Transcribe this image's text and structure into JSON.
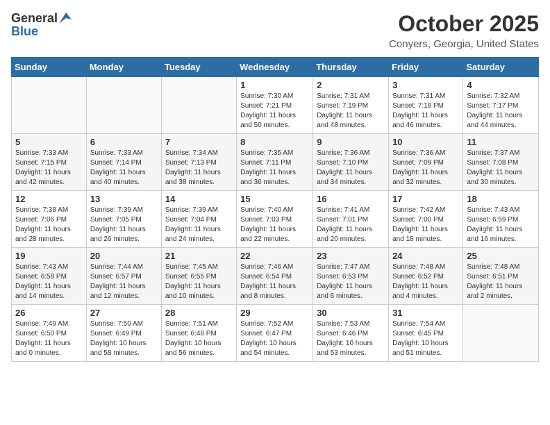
{
  "header": {
    "logo_general": "General",
    "logo_blue": "Blue",
    "month_title": "October 2025",
    "location": "Conyers, Georgia, United States"
  },
  "weekdays": [
    "Sunday",
    "Monday",
    "Tuesday",
    "Wednesday",
    "Thursday",
    "Friday",
    "Saturday"
  ],
  "weeks": [
    [
      {
        "day": "",
        "info": ""
      },
      {
        "day": "",
        "info": ""
      },
      {
        "day": "",
        "info": ""
      },
      {
        "day": "1",
        "info": "Sunrise: 7:30 AM\nSunset: 7:21 PM\nDaylight: 11 hours\nand 50 minutes."
      },
      {
        "day": "2",
        "info": "Sunrise: 7:31 AM\nSunset: 7:19 PM\nDaylight: 11 hours\nand 48 minutes."
      },
      {
        "day": "3",
        "info": "Sunrise: 7:31 AM\nSunset: 7:18 PM\nDaylight: 11 hours\nand 46 minutes."
      },
      {
        "day": "4",
        "info": "Sunrise: 7:32 AM\nSunset: 7:17 PM\nDaylight: 11 hours\nand 44 minutes."
      }
    ],
    [
      {
        "day": "5",
        "info": "Sunrise: 7:33 AM\nSunset: 7:15 PM\nDaylight: 11 hours\nand 42 minutes."
      },
      {
        "day": "6",
        "info": "Sunrise: 7:33 AM\nSunset: 7:14 PM\nDaylight: 11 hours\nand 40 minutes."
      },
      {
        "day": "7",
        "info": "Sunrise: 7:34 AM\nSunset: 7:13 PM\nDaylight: 11 hours\nand 38 minutes."
      },
      {
        "day": "8",
        "info": "Sunrise: 7:35 AM\nSunset: 7:11 PM\nDaylight: 11 hours\nand 36 minutes."
      },
      {
        "day": "9",
        "info": "Sunrise: 7:36 AM\nSunset: 7:10 PM\nDaylight: 11 hours\nand 34 minutes."
      },
      {
        "day": "10",
        "info": "Sunrise: 7:36 AM\nSunset: 7:09 PM\nDaylight: 11 hours\nand 32 minutes."
      },
      {
        "day": "11",
        "info": "Sunrise: 7:37 AM\nSunset: 7:08 PM\nDaylight: 11 hours\nand 30 minutes."
      }
    ],
    [
      {
        "day": "12",
        "info": "Sunrise: 7:38 AM\nSunset: 7:06 PM\nDaylight: 11 hours\nand 28 minutes."
      },
      {
        "day": "13",
        "info": "Sunrise: 7:39 AM\nSunset: 7:05 PM\nDaylight: 11 hours\nand 26 minutes."
      },
      {
        "day": "14",
        "info": "Sunrise: 7:39 AM\nSunset: 7:04 PM\nDaylight: 11 hours\nand 24 minutes."
      },
      {
        "day": "15",
        "info": "Sunrise: 7:40 AM\nSunset: 7:03 PM\nDaylight: 11 hours\nand 22 minutes."
      },
      {
        "day": "16",
        "info": "Sunrise: 7:41 AM\nSunset: 7:01 PM\nDaylight: 11 hours\nand 20 minutes."
      },
      {
        "day": "17",
        "info": "Sunrise: 7:42 AM\nSunset: 7:00 PM\nDaylight: 11 hours\nand 18 minutes."
      },
      {
        "day": "18",
        "info": "Sunrise: 7:43 AM\nSunset: 6:59 PM\nDaylight: 11 hours\nand 16 minutes."
      }
    ],
    [
      {
        "day": "19",
        "info": "Sunrise: 7:43 AM\nSunset: 6:58 PM\nDaylight: 11 hours\nand 14 minutes."
      },
      {
        "day": "20",
        "info": "Sunrise: 7:44 AM\nSunset: 6:57 PM\nDaylight: 11 hours\nand 12 minutes."
      },
      {
        "day": "21",
        "info": "Sunrise: 7:45 AM\nSunset: 6:55 PM\nDaylight: 11 hours\nand 10 minutes."
      },
      {
        "day": "22",
        "info": "Sunrise: 7:46 AM\nSunset: 6:54 PM\nDaylight: 11 hours\nand 8 minutes."
      },
      {
        "day": "23",
        "info": "Sunrise: 7:47 AM\nSunset: 6:53 PM\nDaylight: 11 hours\nand 6 minutes."
      },
      {
        "day": "24",
        "info": "Sunrise: 7:48 AM\nSunset: 6:52 PM\nDaylight: 11 hours\nand 4 minutes."
      },
      {
        "day": "25",
        "info": "Sunrise: 7:48 AM\nSunset: 6:51 PM\nDaylight: 11 hours\nand 2 minutes."
      }
    ],
    [
      {
        "day": "26",
        "info": "Sunrise: 7:49 AM\nSunset: 6:50 PM\nDaylight: 11 hours\nand 0 minutes."
      },
      {
        "day": "27",
        "info": "Sunrise: 7:50 AM\nSunset: 6:49 PM\nDaylight: 10 hours\nand 58 minutes."
      },
      {
        "day": "28",
        "info": "Sunrise: 7:51 AM\nSunset: 6:48 PM\nDaylight: 10 hours\nand 56 minutes."
      },
      {
        "day": "29",
        "info": "Sunrise: 7:52 AM\nSunset: 6:47 PM\nDaylight: 10 hours\nand 54 minutes."
      },
      {
        "day": "30",
        "info": "Sunrise: 7:53 AM\nSunset: 6:46 PM\nDaylight: 10 hours\nand 53 minutes."
      },
      {
        "day": "31",
        "info": "Sunrise: 7:54 AM\nSunset: 6:45 PM\nDaylight: 10 hours\nand 51 minutes."
      },
      {
        "day": "",
        "info": ""
      }
    ]
  ]
}
